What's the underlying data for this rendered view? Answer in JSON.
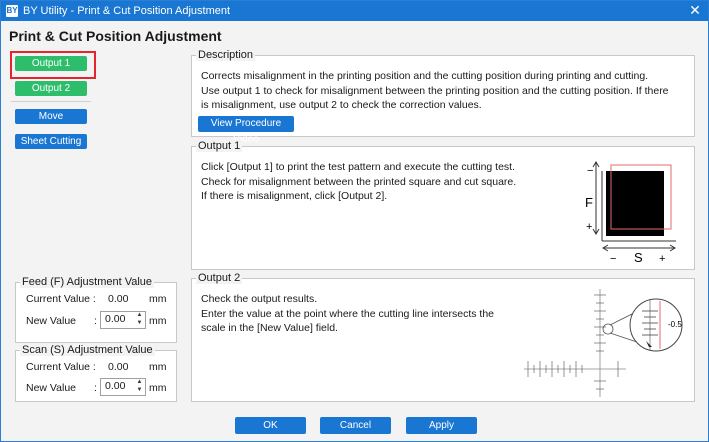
{
  "window": {
    "app_icon_text": "BY",
    "title": "BY Utility - Print & Cut Position Adjustment",
    "close_glyph": "✕"
  },
  "page_title": "Print & Cut Position Adjustment",
  "left_buttons": {
    "output1": "Output 1",
    "output2": "Output 2",
    "move": "Move",
    "sheet_cutting": "Sheet Cutting"
  },
  "feed": {
    "title": "Feed (F) Adjustment Value",
    "current_label": "Current Value :",
    "current_value": "0.00",
    "current_unit": "mm",
    "new_label": "New Value",
    "colon": ":",
    "new_value": "0.00",
    "new_unit": "mm"
  },
  "scan": {
    "title": "Scan (S) Adjustment Value",
    "current_label": "Current Value :",
    "current_value": "0.00",
    "current_unit": "mm",
    "new_label": "New Value",
    "colon": ":",
    "new_value": "0.00",
    "new_unit": "mm"
  },
  "description": {
    "title": "Description",
    "lines": [
      "Corrects misalignment in the printing position and the cutting position during printing and cutting.",
      "Use output 1 to check for misalignment between the printing position and the cutting position. If there",
      "is misalignment, use output 2 to check the correction values."
    ],
    "video_button": "View Procedure Video"
  },
  "output1_panel": {
    "title": "Output 1",
    "lines": [
      "Click [Output 1] to print the test pattern and execute the cutting test.",
      "Check for misalignment between the printed square and cut square.",
      "If there is misalignment, click [Output 2]."
    ],
    "diagram": {
      "f_label": "F",
      "s_label": "S",
      "minus": "−",
      "plus": "+"
    }
  },
  "output2_panel": {
    "title": "Output 2",
    "lines": [
      "Check the output results.",
      "Enter the value at the point where the cutting line intersects the",
      "scale in the [New Value] field."
    ],
    "diagram": {
      "callout_value": "-0.5"
    }
  },
  "footer": {
    "ok": "OK",
    "cancel": "Cancel",
    "apply": "Apply"
  },
  "colors": {
    "accent_blue": "#1976d2",
    "accent_green": "#2ebd6b",
    "selection_red": "#e3262c"
  }
}
